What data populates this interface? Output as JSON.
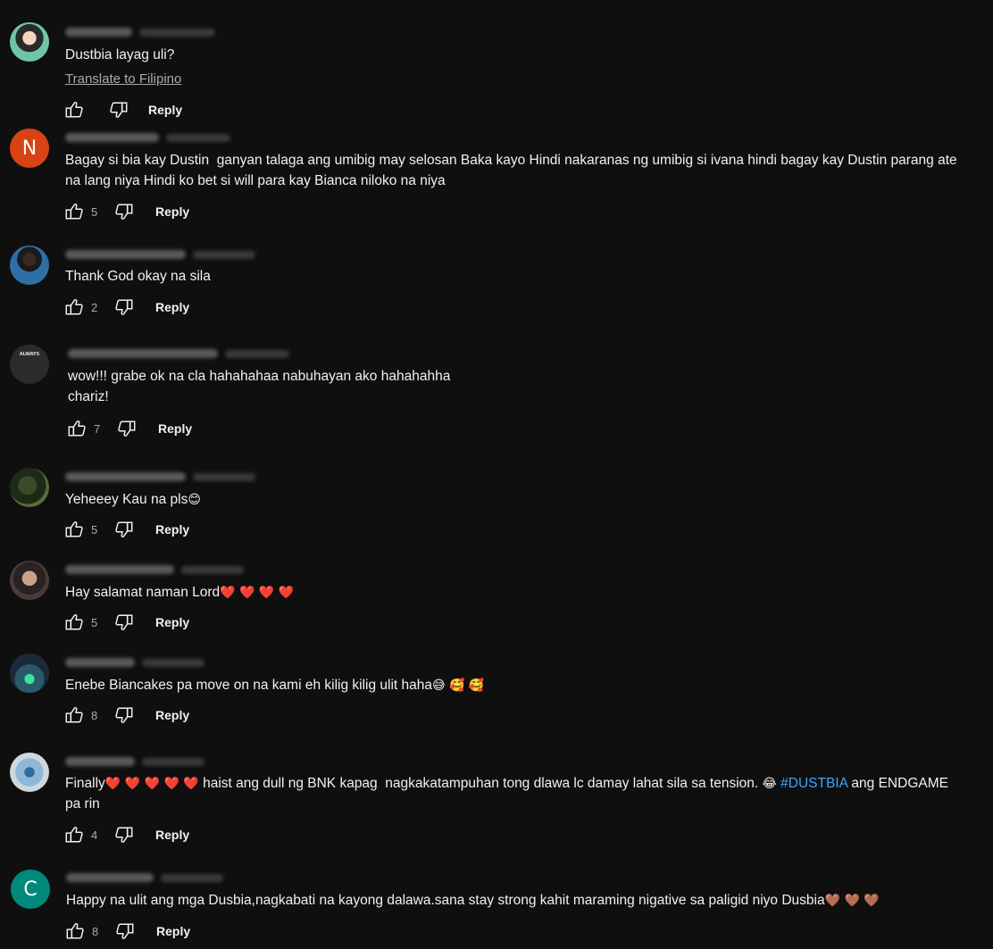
{
  "comments": [
    {
      "text": "Dustbia layag uli?",
      "translate": "Translate to Filipino",
      "likes": "",
      "reply": "Reply"
    },
    {
      "avatar_letter": "N",
      "text": "Bagay si bia kay Dustin  ganyan talaga ang umibig may selosan Baka kayo Hindi nakaranas ng umibig si ivana hindi bagay kay Dustin parang ate na lang niya Hindi ko bet si will para kay Bianca niloko na niya",
      "likes": "5",
      "reply": "Reply"
    },
    {
      "text": "Thank God okay na sila",
      "likes": "2",
      "reply": "Reply"
    },
    {
      "avatar_text": "ALWAYS",
      "text_line1": "wow!!! grabe ok na cla hahahahaa nabuhayan ako hahahahha",
      "text_line2": "chariz!",
      "likes": "7",
      "reply": "Reply"
    },
    {
      "text": "Yeheeey Kau na pls",
      "emoji": "😊",
      "likes": "5",
      "reply": "Reply"
    },
    {
      "text": "Hay salamat naman Lord",
      "hearts": "❤️ ❤️ ❤️ ❤️",
      "likes": "5",
      "reply": "Reply"
    },
    {
      "text": "Enebe Biancakes pa move on na kami eh kilig kilig ulit haha",
      "emoji": "😅 🥰 🥰",
      "likes": "8",
      "reply": "Reply"
    },
    {
      "text_before": "Finally",
      "hearts": "❤️ ❤️ ❤️ ❤️ ❤️",
      "text_mid": " haist ang dull ng BNK kapag  nagkakatampuhan tong dlawa lc damay lahat sila sa tension. ",
      "emoji": "😂",
      "hashtag": "#DUSTBIA",
      "text_after": " ang ENDGAME",
      "text_line2": "pa rin",
      "likes": "4",
      "reply": "Reply"
    },
    {
      "avatar_letter": "C",
      "text": "Happy na ulit ang mga Dusbia,nagkabati na kayong dalawa.sana stay strong kahit maraming nigative sa paligid niyo Dusbia",
      "hearts": "🤎 🤎 🤎",
      "likes": "8",
      "reply": "Reply"
    }
  ],
  "icons": {
    "like": "thumbs-up-icon",
    "dislike": "thumbs-down-icon"
  },
  "colors": {
    "background": "#0f0f0f",
    "hashtag": "#3ea6ff",
    "avatar_n": "#d84315",
    "avatar_c": "#00897b"
  }
}
